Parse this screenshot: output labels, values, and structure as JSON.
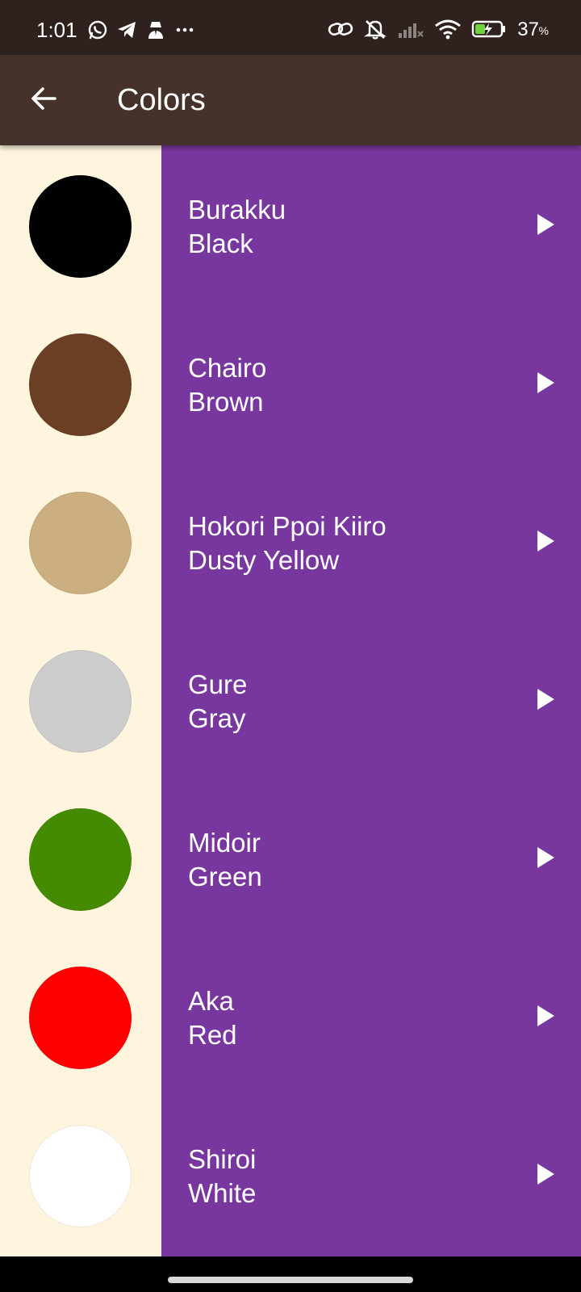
{
  "status_bar": {
    "time": "1:01",
    "battery": "37",
    "battery_unit": "%",
    "icons_left": [
      "whatsapp-icon",
      "telegram-icon",
      "incognito-icon",
      "more-icon"
    ],
    "icons_right": [
      "link-icon",
      "mute-icon",
      "signal-icon",
      "wifi-icon",
      "battery-charging-icon"
    ]
  },
  "app_bar": {
    "title": "Colors",
    "back_icon": "arrow-left-icon"
  },
  "colors": {
    "status_bar_bg": "#2f221e",
    "app_bar_bg": "#45322b",
    "swatch_panel_bg": "#fff5df",
    "item_bg": "#78379e"
  },
  "items": [
    {
      "native": "Burakku",
      "english": "Black",
      "swatch": "#000000"
    },
    {
      "native": "Chairo",
      "english": "Brown",
      "swatch": "#6b3f24"
    },
    {
      "native": "Hokori Ppoi Kiiro",
      "english": "Dusty Yellow",
      "swatch": "#cbaf80"
    },
    {
      "native": "Gure",
      "english": "Gray",
      "swatch": "#cccccc"
    },
    {
      "native": "Midoir",
      "english": "Green",
      "swatch": "#448b00"
    },
    {
      "native": "Aka",
      "english": "Red",
      "swatch": "#ff0000"
    },
    {
      "native": "Shiroi",
      "english": "White",
      "swatch": "#ffffff"
    }
  ],
  "play_icon": "play-icon"
}
